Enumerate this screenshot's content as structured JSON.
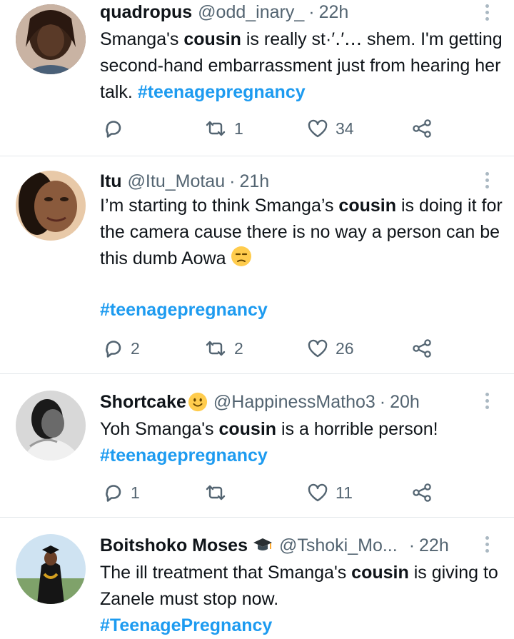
{
  "tweets": [
    {
      "name": "quadropus",
      "handle": "@odd_inary_",
      "dot": "·",
      "time": "22h",
      "text_before": "Smanga's ",
      "bold": "cousin",
      "text_after": " is really st·′․′‥․ shem. I'm getting second-hand embarrassment just from hearing her talk.",
      "hashtag": "#teenagepregnancy",
      "replies": "",
      "retweets": "1",
      "likes": "34"
    },
    {
      "name": "Itu",
      "handle": "@Itu_Motau",
      "dot": "·",
      "time": "21h",
      "text_before": "I’m starting to think Smanga’s ",
      "bold": "cousin",
      "text_after": " is doing it for the camera cause there is no way a person can be this dumb Aowa",
      "hashtag": "#teenagepregnancy",
      "replies": "2",
      "retweets": "2",
      "likes": "26"
    },
    {
      "name": "Shortcake",
      "handle": "@HappinessMatho3",
      "dot": "·",
      "time": "20h",
      "text_before": "Yoh Smanga's ",
      "bold": "cousin",
      "text_after": " is a horrible person!",
      "hashtag": "#teenagepregnancy",
      "replies": "1",
      "retweets": "",
      "likes": "11"
    },
    {
      "name": "Boitshoko Moses",
      "handle": "@Tshoki_Mo...",
      "dot": "·",
      "time": "22h",
      "text_before": "The ill treatment that Smanga's ",
      "bold": "cousin",
      "text_after": " is giving to Zanele must stop now.",
      "hashtag": "#TeenagePregnancy"
    }
  ],
  "icons": {
    "reply": "reply-icon",
    "retweet": "retweet-icon",
    "like": "heart-icon",
    "share": "share-icon",
    "more": "more-icon"
  },
  "colors": {
    "hashtag": "#1d9bf0",
    "secondary_text": "#536471",
    "divider": "#e3e7ea"
  }
}
